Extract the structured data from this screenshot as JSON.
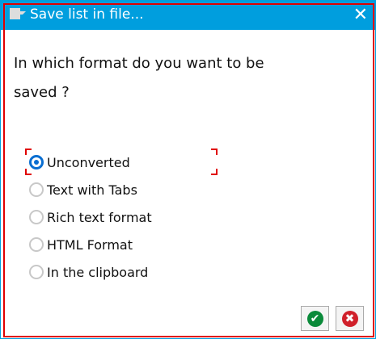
{
  "title": "Save list in file...",
  "question": "In which format do you want to be saved ?",
  "options": [
    {
      "label": "Unconverted",
      "selected": true
    },
    {
      "label": "Text with Tabs",
      "selected": false
    },
    {
      "label": "Rich text format",
      "selected": false
    },
    {
      "label": "HTML Format",
      "selected": false
    },
    {
      "label": "In the clipboard",
      "selected": false
    }
  ],
  "buttons": {
    "ok": "✔",
    "cancel": "✖"
  },
  "colors": {
    "titlebar": "#009ede",
    "ok": "#0a8a3a",
    "cancel": "#d0202a",
    "focus": "#e00000"
  }
}
